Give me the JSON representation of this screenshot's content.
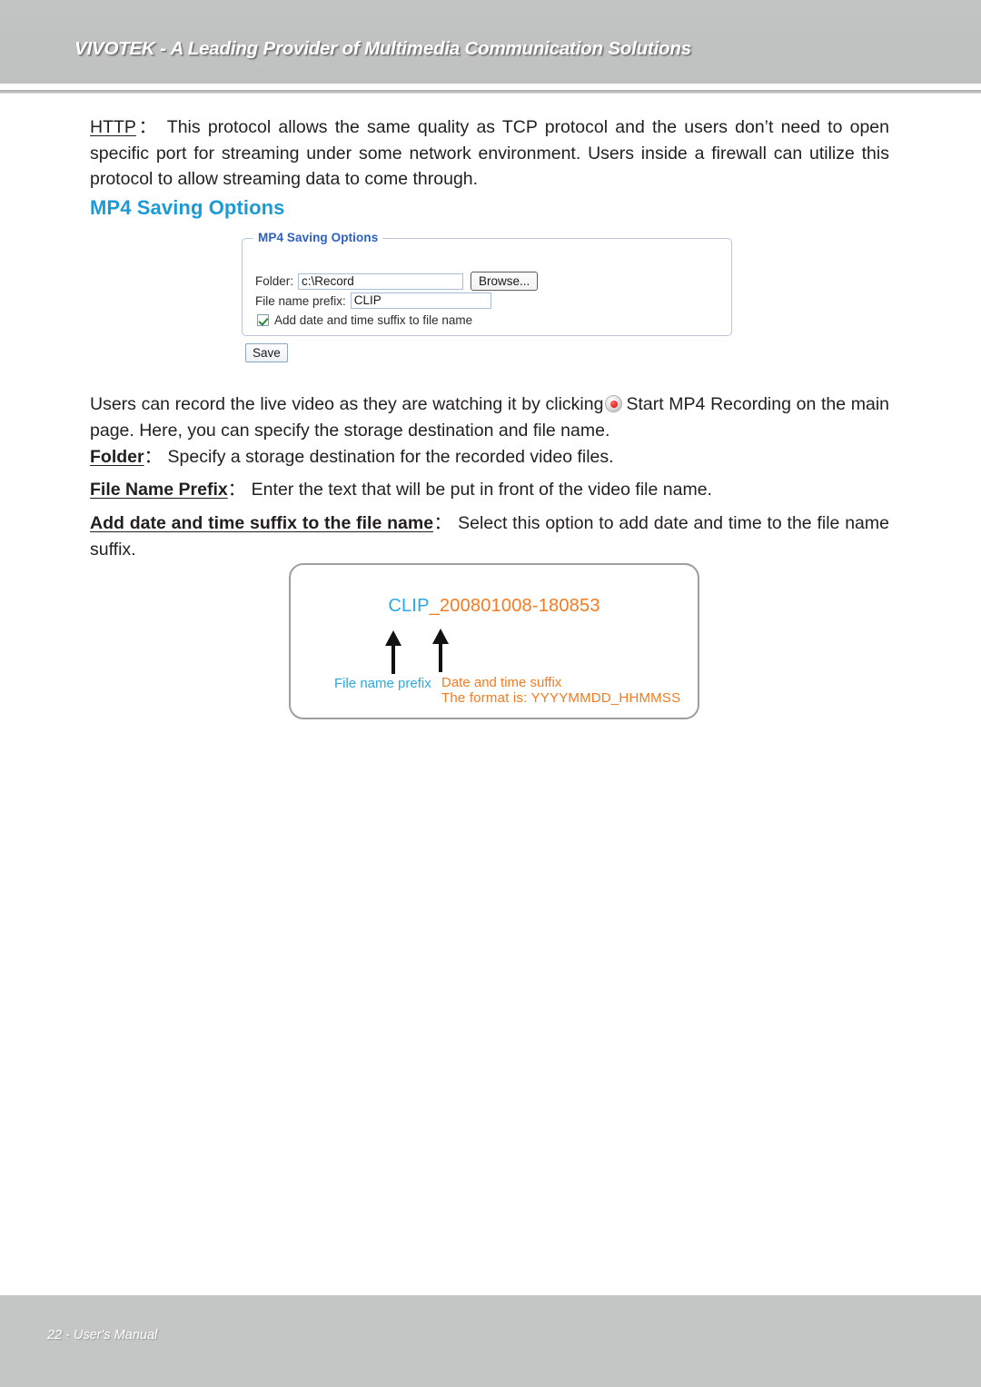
{
  "header": {
    "title": "VIVOTEK - A Leading Provider of Multimedia Communication Solutions"
  },
  "body": {
    "http_term": "HTTP",
    "http_colon": "：",
    "http_text": "This protocol allows the same quality as TCP protocol and the users don’t need to open specific port for streaming under some network environment. Users inside a firewall can utilize this protocol to allow streaming data to come through.",
    "section_heading": "MP4 Saving Options",
    "users_text_before": "Users can record the live video as they are watching it by clicking",
    "users_text_after": "Start MP4 Recording on the main page. Here, you can specify the storage destination and file name.",
    "folder_term": "Folder",
    "folder_colon": "：",
    "folder_text": "Specify a storage destination for the recorded video files.",
    "prefix_term": "File Name Prefix",
    "prefix_colon": "：",
    "prefix_text": "Enter the text that will be put in front of the video file name.",
    "suffix_term": "Add date and time suffix to the file name",
    "suffix_colon": "：",
    "suffix_text": "Select this option to add date and time to the file name suffix."
  },
  "dialog": {
    "legend": "MP4 Saving Options",
    "folder_label": "Folder:",
    "folder_value": "c:\\Record",
    "folder_placeholder": "c:\\Record",
    "browse_label": "Browse...",
    "prefix_label": "File name prefix:",
    "prefix_value": "CLIP",
    "prefix_placeholder": "CLIP",
    "checkbox_label": "Add date and time suffix to file name",
    "checkbox_checked": "true",
    "save_label": "Save"
  },
  "illustration": {
    "filename_prefix": "CLIP",
    "filename_suffix": "_200801008-180853",
    "label_prefix": "File name prefix",
    "label_suffix": "Date and time suffix",
    "label_format": "The format is: YYYYMMDD_HHMMSS"
  },
  "footer": {
    "text": "22 - User's Manual"
  },
  "colors": {
    "heading_blue": "#1c9ad8",
    "legend_blue": "#2b5fc4",
    "accent_cyan": "#2ba9e0",
    "accent_orange": "#f47b20",
    "header_gray": "#c0c2c2",
    "footer_gray": "#c4c6c6",
    "record_red": "#ee2a2a"
  }
}
